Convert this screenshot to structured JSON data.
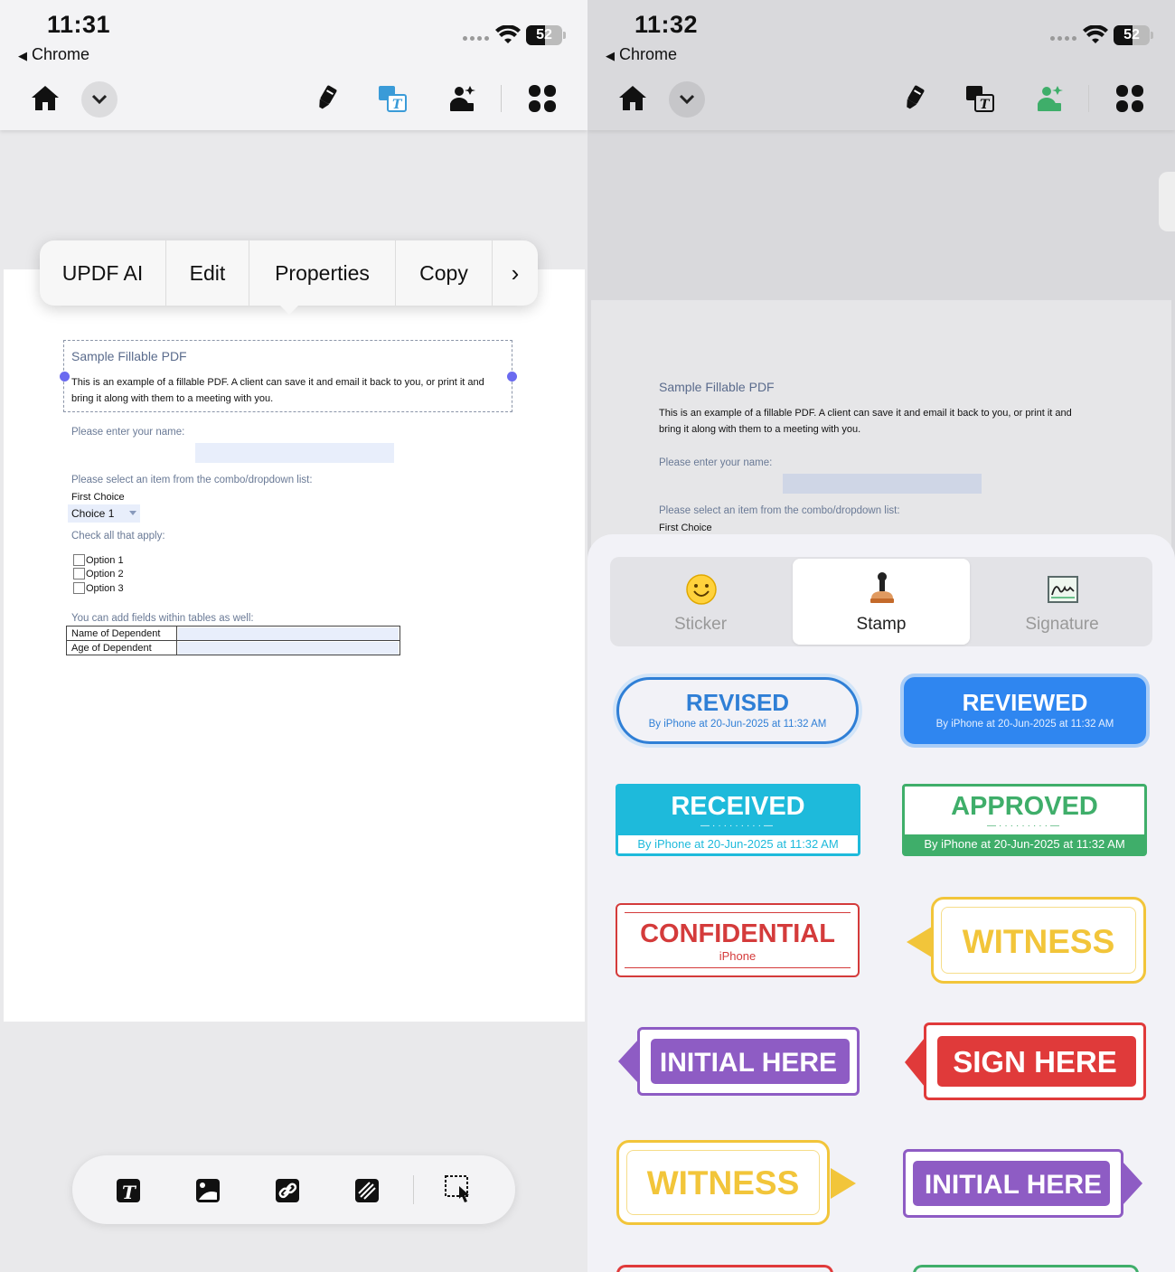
{
  "left": {
    "status": {
      "time": "11:31",
      "back_app": "Chrome",
      "battery": "52"
    },
    "toolbar_icons": [
      "home-icon",
      "chevron-down-icon",
      "highlighter-icon",
      "translate-icon",
      "image-edit-icon",
      "grid-icon"
    ],
    "context_menu": {
      "items": [
        "UPDF AI",
        "Edit",
        "Properties",
        "Copy"
      ],
      "more": "›"
    },
    "pdf": {
      "title": "Sample Fillable PDF",
      "body_line1": "This is an example of a fillable PDF. A client can save it and email it back to you, or print it and",
      "body_line2": "bring it along with them to a meeting with you.",
      "name_label": "Please enter your name:",
      "combo_label": "Please select an item from the combo/dropdown list:",
      "first_choice": "First Choice",
      "combo_value": "Choice 1",
      "check_label": "Check all that apply:",
      "options": [
        "Option 1",
        "Option 2",
        "Option 3"
      ],
      "tables_label": "You can add  fields within tables as well:",
      "table_rows": [
        "Name of Dependent",
        "Age of Dependent"
      ]
    },
    "bottom_icons": [
      "text-icon",
      "image-icon",
      "link-icon",
      "redact-icon",
      "select-touch-icon"
    ]
  },
  "right": {
    "status": {
      "time": "11:32",
      "back_app": "Chrome",
      "battery": "52"
    },
    "pdf": {
      "title": "Sample Fillable PDF",
      "body_line1": "This is an example of a fillable PDF. A client can save it and email it back to you, or print it and",
      "body_line2": "bring it along with them to a meeting with you.",
      "name_label": "Please enter your name:",
      "combo_label": "Please select an item from the combo/dropdown list:",
      "first_choice": "First Choice"
    },
    "tabs": [
      "Sticker",
      "Stamp",
      "Signature"
    ],
    "active_tab": "Stamp",
    "stamps": [
      {
        "title": "REVISED",
        "sub": "By iPhone at 20-Jun-2025 at 11:32 AM",
        "color": "#2f7fd6"
      },
      {
        "title": "REVIEWED",
        "sub": "By iPhone at 20-Jun-2025 at 11:32 AM",
        "color": "#2f86f0"
      },
      {
        "title": "RECEIVED",
        "sub": "By iPhone at 20-Jun-2025 at 11:32 AM",
        "color": "#1ebadb"
      },
      {
        "title": "APPROVED",
        "sub": "By iPhone at 20-Jun-2025 at 11:32 AM",
        "color": "#3fae6a"
      },
      {
        "title": "CONFIDENTIAL",
        "sub": "iPhone",
        "color": "#d43b3b"
      },
      {
        "title": "WITNESS",
        "sub": "",
        "color": "#f2c53a"
      },
      {
        "title": "INITIAL HERE",
        "sub": "",
        "color": "#8e5cc4"
      },
      {
        "title": "SIGN HERE",
        "sub": "",
        "color": "#e03a3a"
      },
      {
        "title": "WITNESS",
        "sub": "",
        "color": "#f2c53a"
      },
      {
        "title": "INITIAL HERE",
        "sub": "",
        "color": "#8e5cc4"
      }
    ]
  }
}
